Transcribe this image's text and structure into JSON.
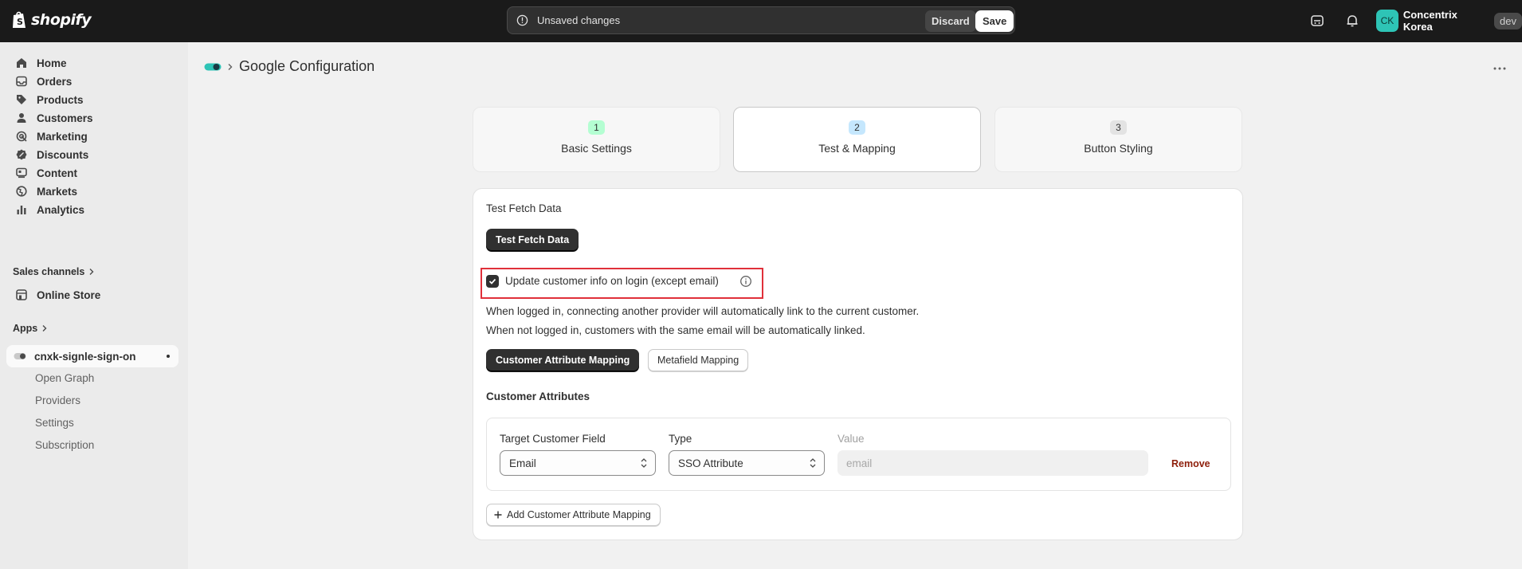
{
  "topbar": {
    "logo_text": "shopify",
    "save_bar": {
      "message": "Unsaved changes",
      "discard_label": "Discard",
      "save_label": "Save"
    },
    "user": {
      "initials": "CK",
      "store_name": "Concentrix Korea",
      "badge": "dev"
    },
    "icons": [
      "alert-circle-icon",
      "chat-icon",
      "bell-icon"
    ]
  },
  "sidebar": {
    "items": [
      {
        "label": "Home",
        "icon": "home-icon"
      },
      {
        "label": "Orders",
        "icon": "inbox-icon"
      },
      {
        "label": "Products",
        "icon": "tag-icon"
      },
      {
        "label": "Customers",
        "icon": "person-icon"
      },
      {
        "label": "Marketing",
        "icon": "target-icon"
      },
      {
        "label": "Discounts",
        "icon": "discount-icon"
      },
      {
        "label": "Content",
        "icon": "content-icon"
      },
      {
        "label": "Markets",
        "icon": "globe-icon"
      },
      {
        "label": "Analytics",
        "icon": "bar-chart-icon"
      }
    ],
    "sales_channels_label": "Sales channels",
    "online_store_label": "Online Store",
    "apps_label": "Apps",
    "app": {
      "name": "cnxk-signle-sign-on",
      "sub_items": [
        "Open Graph",
        "Providers",
        "Settings",
        "Subscription"
      ]
    }
  },
  "page": {
    "title": "Google Configuration",
    "steps": [
      {
        "number": "1",
        "label": "Basic Settings",
        "color": "#b4fed2"
      },
      {
        "number": "2",
        "label": "Test & Mapping",
        "color": "#c5e7fd",
        "active": true
      },
      {
        "number": "3",
        "label": "Button Styling",
        "color": "#e3e3e3"
      }
    ]
  },
  "card": {
    "title": "Test Fetch Data",
    "test_button": "Test Fetch Data",
    "checkbox_label": "Update customer info on login (except email)",
    "checkbox_checked": true,
    "help_line_1": "When logged in, connecting another provider will automatically link to the current customer.",
    "help_line_2": "When not logged in, customers with the same email will be automatically linked.",
    "tabs": {
      "active": "Customer Attribute Mapping",
      "inactive": "Metafield Mapping"
    },
    "section_title": "Customer Attributes",
    "mapping": {
      "target_label": "Target Customer Field",
      "target_value": "Email",
      "type_label": "Type",
      "type_value": "SSO Attribute",
      "value_label": "Value",
      "value_placeholder": "email",
      "remove_label": "Remove"
    },
    "add_button": "Add Customer Attribute Mapping"
  }
}
